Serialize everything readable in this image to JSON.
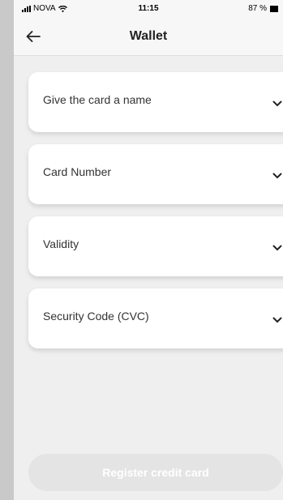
{
  "status_bar": {
    "carrier": "NOVA",
    "time": "11:15",
    "battery": "87 %"
  },
  "header": {
    "title": "Wallet",
    "back_icon": "arrow-left-icon"
  },
  "fields": [
    {
      "label": "Give the card a name",
      "icon": "chevron-down-icon"
    },
    {
      "label": "Card Number",
      "icon": "chevron-down-icon"
    },
    {
      "label": "Validity",
      "icon": "chevron-down-icon"
    },
    {
      "label": "Security Code (CVC)",
      "icon": "chevron-down-icon"
    }
  ],
  "register_button": {
    "label": "Register credit card",
    "state": "disabled"
  },
  "colors": {
    "background": "#efefef",
    "card": "#ffffff",
    "button_disabled": "#e4e4e4"
  }
}
